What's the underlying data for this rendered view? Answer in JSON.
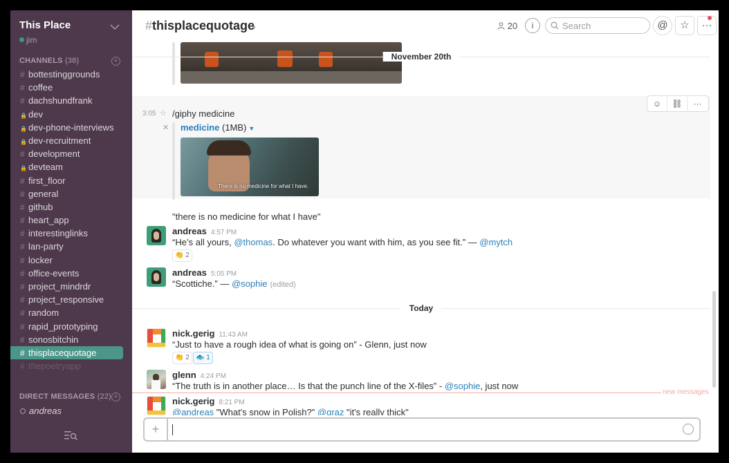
{
  "team": {
    "name": "This Place",
    "user": "jim"
  },
  "sidebar": {
    "channels_label": "CHANNELS",
    "channels_count": "(38)",
    "channels": [
      {
        "prefix": "#",
        "name": "bottestinggrounds"
      },
      {
        "prefix": "#",
        "name": "coffee"
      },
      {
        "prefix": "#",
        "name": "dachshundfrank"
      },
      {
        "prefix": "🔒",
        "name": "dev"
      },
      {
        "prefix": "🔒",
        "name": "dev-phone-interviews"
      },
      {
        "prefix": "🔒",
        "name": "dev-recruitment"
      },
      {
        "prefix": "#",
        "name": "development"
      },
      {
        "prefix": "🔒",
        "name": "devteam"
      },
      {
        "prefix": "#",
        "name": "first_floor"
      },
      {
        "prefix": "#",
        "name": "general"
      },
      {
        "prefix": "#",
        "name": "github"
      },
      {
        "prefix": "#",
        "name": "heart_app"
      },
      {
        "prefix": "#",
        "name": "interestinglinks"
      },
      {
        "prefix": "#",
        "name": "lan-party"
      },
      {
        "prefix": "#",
        "name": "locker"
      },
      {
        "prefix": "#",
        "name": "office-events"
      },
      {
        "prefix": "#",
        "name": "project_mindrdr"
      },
      {
        "prefix": "#",
        "name": "project_responsive"
      },
      {
        "prefix": "#",
        "name": "random"
      },
      {
        "prefix": "#",
        "name": "rapid_prototyping"
      },
      {
        "prefix": "#",
        "name": "sonosbitchin"
      },
      {
        "prefix": "#",
        "name": "thisplacequotage"
      },
      {
        "prefix": "#",
        "name": "thepoetryapp"
      }
    ],
    "dm_label": "DIRECT MESSAGES",
    "dm_count": "(22)",
    "dm_user": "andreas"
  },
  "header": {
    "hash": "#",
    "channel": "thisplacequotage",
    "member_count": "20",
    "search_placeholder": "Search",
    "at_symbol": "@",
    "star_symbol": "☆",
    "more_symbol": "···",
    "info_symbol": "i"
  },
  "messages": {
    "divider_1": "November 20th",
    "hover_time": "3:05",
    "giphy_command": "/giphy medicine",
    "attach_title": "medicine",
    "attach_size": "(1MB)",
    "quote_1": "\"there is no medicine for what I have\"",
    "m1": {
      "author": "andreas",
      "time": "4:57 PM",
      "text_a": "“He’s all yours, ",
      "mention_a": "@thomas",
      "text_b": ". Do whatever you want with him, as you see fit.” — ",
      "mention_b": "@mytch",
      "reaction_count": "2"
    },
    "m2": {
      "author": "andreas",
      "time": "5:05 PM",
      "text_a": "“Scottiche.” — ",
      "mention_a": "@sophie",
      "edited": "(edited)"
    },
    "divider_2": "Today",
    "m3": {
      "author": "nick.gerig",
      "time": "11:43 AM",
      "text": "“Just to have a rough idea of what is going on” - Glenn, just now",
      "reaction_1_count": "2",
      "reaction_2_count": "1"
    },
    "m4": {
      "author": "glenn",
      "time": "4:24 PM",
      "text_a": "“The truth is in another place… Is that the punch line of the X-files” - ",
      "mention_a": "@sophie",
      "text_b": ", just now"
    },
    "new_label": "new messages",
    "m5": {
      "author": "nick.gerig",
      "time": "8:21 PM",
      "mention_a": "@andreas",
      "text_a": " \"What's snow in Polish?\" ",
      "mention_b": "@graz",
      "text_b": " \"it's really thick\""
    },
    "image_caption": "There is no medicine for what I have."
  },
  "composer": {
    "plus": "+"
  }
}
